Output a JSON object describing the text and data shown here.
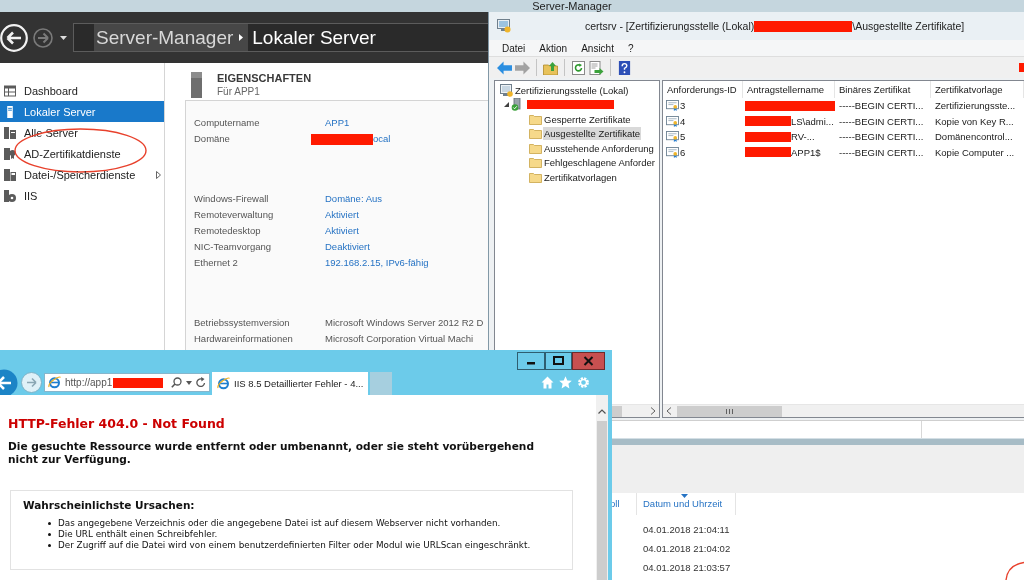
{
  "server_manager": {
    "title": "Server-Manager",
    "breadcrumb": {
      "root": "Server-Manager",
      "page": "Lokaler Server"
    },
    "sidebar": [
      {
        "label": "Dashboard",
        "kind": "dashboard",
        "selected": false,
        "expandable": false,
        "circled": false
      },
      {
        "label": "Lokaler Server",
        "kind": "server",
        "selected": true,
        "expandable": false,
        "circled": false
      },
      {
        "label": "Alle Server",
        "kind": "servers",
        "selected": false,
        "expandable": false,
        "circled": false
      },
      {
        "label": "AD-Zertifikatdienste",
        "kind": "certificate",
        "selected": false,
        "expandable": false,
        "circled": true
      },
      {
        "label": "Datei-/Speicherdienste",
        "kind": "storage",
        "selected": false,
        "expandable": true,
        "circled": false
      },
      {
        "label": "IIS",
        "kind": "iis",
        "selected": false,
        "expandable": false,
        "circled": false
      }
    ],
    "properties": {
      "title": "EIGENSCHAFTEN",
      "subtitle": "Für APP1",
      "groups": [
        [
          {
            "label": "Computername",
            "value": "APP1",
            "link": true,
            "redacted": false
          },
          {
            "label": "Domäne",
            "value": "ocal",
            "link": true,
            "redacted": true
          }
        ],
        [
          {
            "label": "Windows-Firewall",
            "value": "Domäne: Aus",
            "link": true,
            "redacted": false
          },
          {
            "label": "Remoteverwaltung",
            "value": "Aktiviert",
            "link": true,
            "redacted": false
          },
          {
            "label": "Remotedesktop",
            "value": "Aktiviert",
            "link": true,
            "redacted": false
          },
          {
            "label": "NIC-Teamvorgang",
            "value": "Deaktiviert",
            "link": true,
            "redacted": false
          },
          {
            "label": "Ethernet 2",
            "value": "192.168.2.15, IPv6-fähig",
            "link": true,
            "redacted": false
          }
        ],
        [
          {
            "label": "Betriebssystemversion",
            "value": "Microsoft Windows Server 2012 R2 D",
            "link": false,
            "redacted": false
          },
          {
            "label": "Hardwareinformationen",
            "value": "Microsoft Corporation Virtual Machi",
            "link": false,
            "redacted": false
          }
        ]
      ]
    },
    "events": {
      "columns": [
        {
          "label": "oll",
          "sorted": false
        },
        {
          "label": "Datum und Uhrzeit",
          "sorted": true
        }
      ],
      "rows": [
        {
          "date": "04.01.2018 21:04:11"
        },
        {
          "date": "04.01.2018 21:04:02"
        },
        {
          "date": "04.01.2018 21:03:57"
        }
      ]
    }
  },
  "certsrv": {
    "title": "certsrv - [Zertifizierungsstelle (Lokal)",
    "title_redacted": true,
    "title_end": "\\Ausgestellte Zertifikate]",
    "menu": [
      "Datei",
      "Aktion",
      "Ansicht",
      "?"
    ],
    "toolbar": {
      "groups": [
        [
          {
            "kind": "back",
            "disabled": false
          },
          {
            "kind": "forward",
            "disabled": true
          }
        ],
        [
          {
            "kind": "up-folder",
            "disabled": false
          }
        ],
        [
          {
            "kind": "refresh",
            "disabled": false
          },
          {
            "kind": "export",
            "disabled": false
          }
        ],
        [
          {
            "kind": "help",
            "disabled": false
          }
        ]
      ],
      "redacted": true
    },
    "tree": {
      "label": "Zertifizierungsstelle (Lokal)",
      "children": [
        {
          "redacted": true,
          "expanded": true,
          "children": [
            {
              "label": "Gesperrte Zertifikate",
              "selected": false
            },
            {
              "label": "Ausgestellte Zertifikate",
              "selected": true
            },
            {
              "label": "Ausstehende Anforderung",
              "selected": false
            },
            {
              "label": "Fehlgeschlagene Anforder",
              "selected": false
            },
            {
              "label": "Zertifikatvorlagen",
              "selected": false
            }
          ]
        }
      ]
    },
    "columns": [
      "Anforderungs-ID",
      "Antragstellername",
      "Binäres Zertifikat",
      "Zertifikatvorlage"
    ],
    "rows": [
      {
        "id": "3",
        "redacted": true,
        "selected": false,
        "binary": "-----BEGIN CERTI...",
        "template": "Zertifizierungsste..."
      },
      {
        "id": "4",
        "redacted": true,
        "selected": false,
        "requester": "LS\\admi...",
        "binary": "-----BEGIN CERTI...",
        "template": "Kopie von Key R..."
      },
      {
        "id": "5",
        "redacted": true,
        "selected": false,
        "requester": "RV-...",
        "binary": "-----BEGIN CERTI...",
        "template": "Domänencontrol..."
      },
      {
        "id": "6",
        "redacted": true,
        "selected": false,
        "requester": "APP1$",
        "binary": "-----BEGIN CERTI...",
        "template": "Kopie Computer ..."
      }
    ]
  },
  "browser": {
    "address": "http://app1",
    "address_redacted": true,
    "tab": "IIS 8.5 Detaillierter Fehler - 4...",
    "heading": "HTTP-Fehler 404.0 - Not Found",
    "message": "Die gesuchte Ressource wurde entfernt oder umbenannt, oder sie steht vorübergehend nicht zur Verfügung.",
    "causes": {
      "title": "Wahrscheinlichste Ursachen:",
      "items": [
        "Das angegebene Verzeichnis oder die angegebene Datei ist auf diesem Webserver nicht vorhanden.",
        "Die URL enthält einen Schreibfehler.",
        "Der Zugriff auf die Datei wird von einem benutzerdefinierten Filter oder Modul wie URLScan eingeschränkt."
      ]
    }
  },
  "annotations": [
    {
      "kind": "partial-circle"
    }
  ]
}
